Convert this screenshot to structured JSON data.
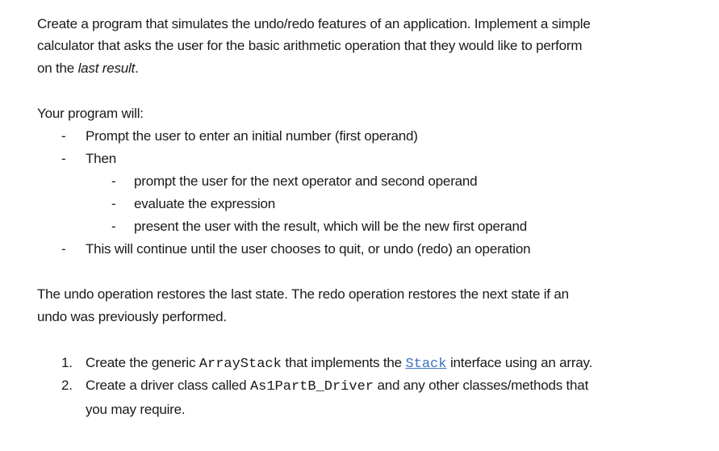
{
  "intro": {
    "line1": "Create a program that simulates the undo/redo features of an application.  Implement a simple",
    "line2": "calculator that asks the user for the basic arithmetic operation that they would like to perform",
    "line3_prefix": "on the ",
    "line3_em": "last result",
    "line3_suffix": "."
  },
  "program": {
    "heading": "Your program will:",
    "dash": "-",
    "items": [
      "Prompt the user to enter an initial number (first operand)",
      "Then",
      "This will continue until the user chooses to quit, or undo (redo) an operation"
    ],
    "subitems": [
      "prompt the user for the next operator and second operand",
      "evaluate the expression",
      "present the user with the result, which will be the new first operand"
    ]
  },
  "undo": {
    "line1": "The undo operation restores the last state.  The redo operation restores the next state if an",
    "line2": "undo was previously performed."
  },
  "tasks": {
    "t1_num": "1.",
    "t1_a": "Create the generic ",
    "t1_code": "ArrayStack",
    "t1_b": " that implements the ",
    "t1_link": "Stack",
    "t1_c": " interface using an array.",
    "t2_num": "2.",
    "t2_a": "Create a driver class called ",
    "t2_code": "As1PartB_Driver",
    "t2_b": " and any other classes/methods that",
    "t2_line2": "you may require."
  }
}
